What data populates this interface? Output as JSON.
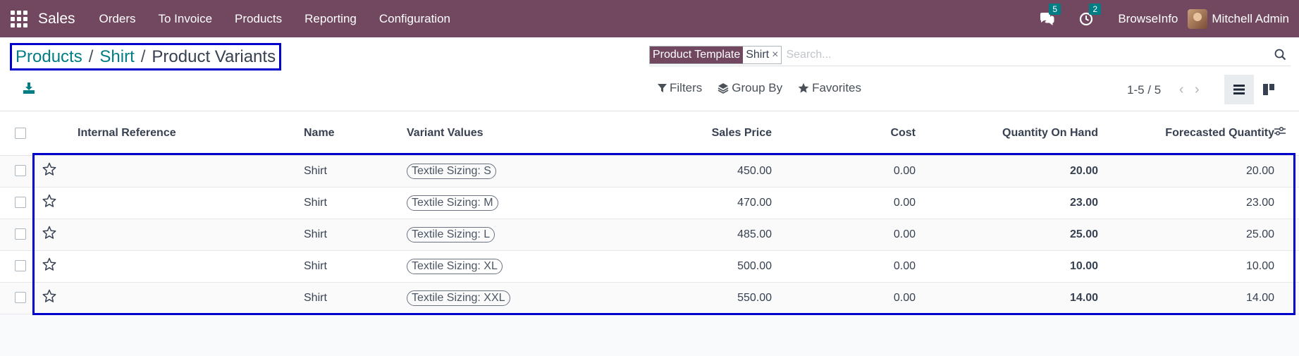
{
  "navbar": {
    "app_name": "Sales",
    "menu": [
      "Orders",
      "To Invoice",
      "Products",
      "Reporting",
      "Configuration"
    ],
    "messages_count": "5",
    "activities_count": "2",
    "company": "BrowseInfo",
    "user": "Mitchell Admin"
  },
  "breadcrumb": {
    "items": [
      "Products",
      "Shirt"
    ],
    "current": "Product Variants",
    "separator": "/"
  },
  "search": {
    "facet_label": "Product Template",
    "facet_value": "Shirt",
    "facet_remove": "×",
    "placeholder": "Search..."
  },
  "filters": {
    "filters_label": "Filters",
    "groupby_label": "Group By",
    "favorites_label": "Favorites"
  },
  "pager": {
    "value": "1-5 / 5"
  },
  "table": {
    "columns": [
      "Internal Reference",
      "Name",
      "Variant Values",
      "Sales Price",
      "Cost",
      "Quantity On Hand",
      "Forecasted Quantity"
    ],
    "rows": [
      {
        "internal_ref": "",
        "name": "Shirt",
        "variant": "Textile Sizing: S",
        "sales_price": "450.00",
        "cost": "0.00",
        "qty_on_hand": "20.00",
        "forecasted": "20.00"
      },
      {
        "internal_ref": "",
        "name": "Shirt",
        "variant": "Textile Sizing: M",
        "sales_price": "470.00",
        "cost": "0.00",
        "qty_on_hand": "23.00",
        "forecasted": "23.00"
      },
      {
        "internal_ref": "",
        "name": "Shirt",
        "variant": "Textile Sizing: L",
        "sales_price": "485.00",
        "cost": "0.00",
        "qty_on_hand": "25.00",
        "forecasted": "25.00"
      },
      {
        "internal_ref": "",
        "name": "Shirt",
        "variant": "Textile Sizing: XL",
        "sales_price": "500.00",
        "cost": "0.00",
        "qty_on_hand": "10.00",
        "forecasted": "10.00"
      },
      {
        "internal_ref": "",
        "name": "Shirt",
        "variant": "Textile Sizing: XXL",
        "sales_price": "550.00",
        "cost": "0.00",
        "qty_on_hand": "14.00",
        "forecasted": "14.00"
      }
    ]
  },
  "colors": {
    "navbar": "#71485f",
    "link": "#017e84",
    "highlight_box": "#0000cc"
  }
}
